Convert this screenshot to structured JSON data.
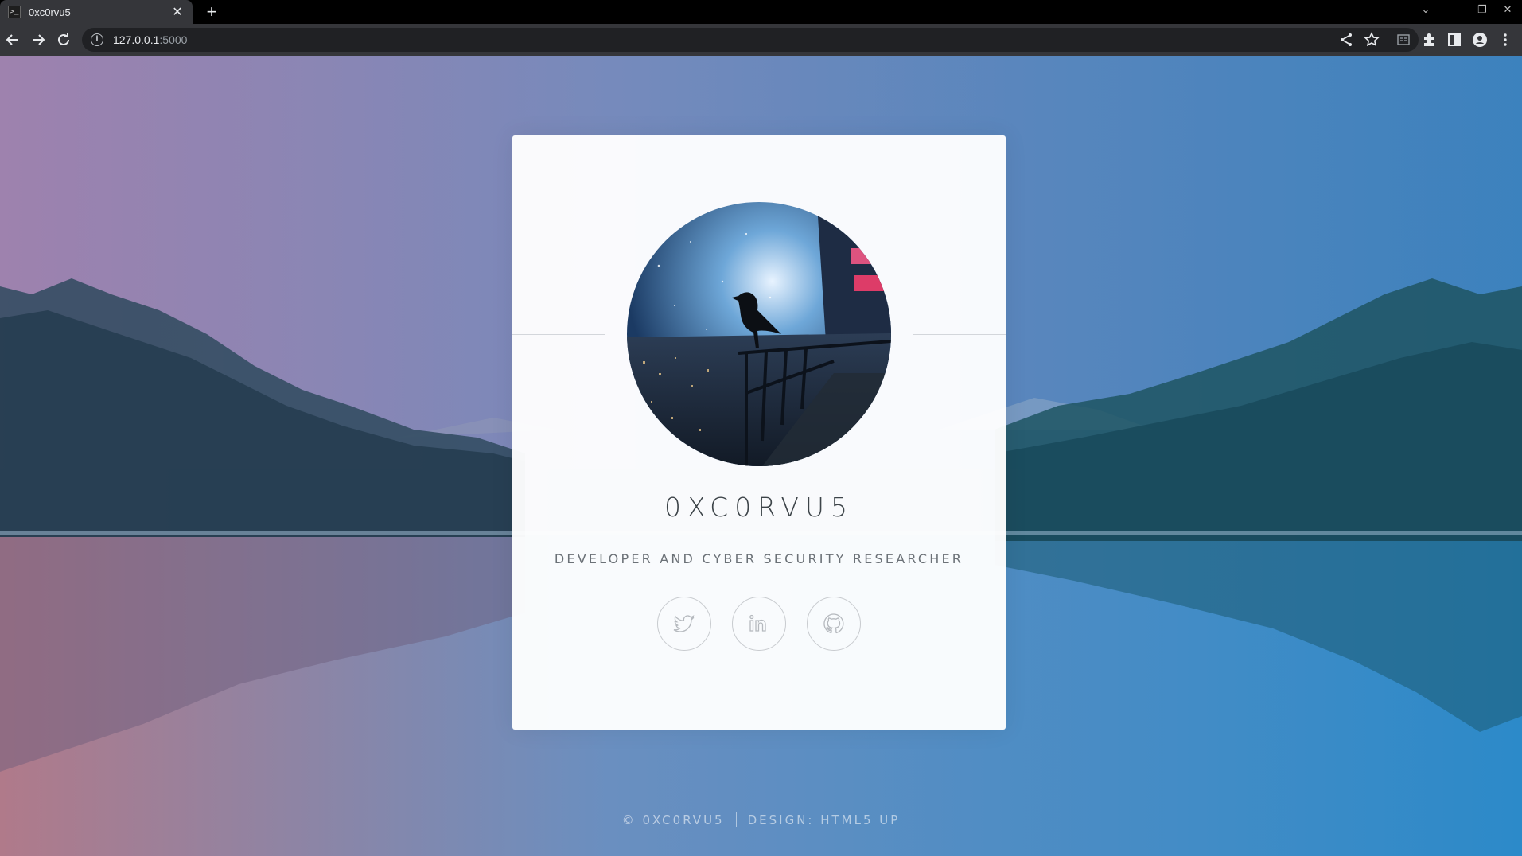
{
  "browser": {
    "tab_title": "0xc0rvu5",
    "tab_favicon": ">_",
    "close_glyph": "✕",
    "new_tab_glyph": "+",
    "url_host": "127.0.0.1",
    "url_port": ":5000",
    "window_controls": {
      "tab_search": "⌄",
      "minimize": "–",
      "restore": "❐",
      "close": "✕"
    },
    "toolbar_icons": [
      "share-icon",
      "bookmark-star-icon",
      "reader-mode-icon",
      "extensions-icon",
      "side-panel-icon",
      "profile-icon",
      "menu-icon"
    ]
  },
  "page": {
    "name": "0XC0RVU5",
    "tagline": "DEVELOPER AND CYBER SECURITY RESEARCHER",
    "socials": [
      {
        "icon": "twitter-icon"
      },
      {
        "icon": "linkedin-icon"
      },
      {
        "icon": "github-icon"
      }
    ],
    "footer": {
      "copyright": "© 0XC0RVU5",
      "design": "DESIGN: HTML5 UP"
    }
  },
  "colors": {
    "card_bg": "#ffffff",
    "text_dark": "#3d4449",
    "text_muted": "#6b7177",
    "chrome_bg": "#35363a"
  }
}
